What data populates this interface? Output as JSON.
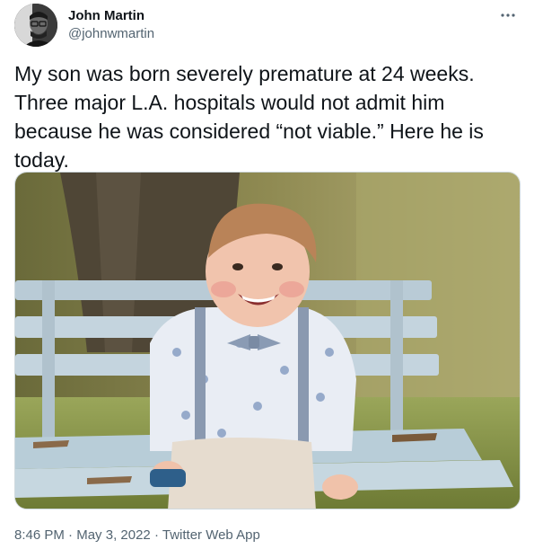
{
  "author": {
    "display_name": "John Martin",
    "handle": "@johnwmartin",
    "avatar_icon": "profile-photo"
  },
  "tweet": {
    "text": "My son was born severely premature at 24 weeks.\nThree major L.A. hospitals would not admit him\nbecause he was considered “not viable.” Here he is\ntoday.",
    "time": "8:46 PM",
    "separator": "·",
    "date": "May 3, 2022",
    "source": "Twitter Web App"
  },
  "media": {
    "type": "photo"
  },
  "colors": {
    "text_primary": "#0f1419",
    "text_secondary": "#536471",
    "border": "#cfd9de"
  }
}
